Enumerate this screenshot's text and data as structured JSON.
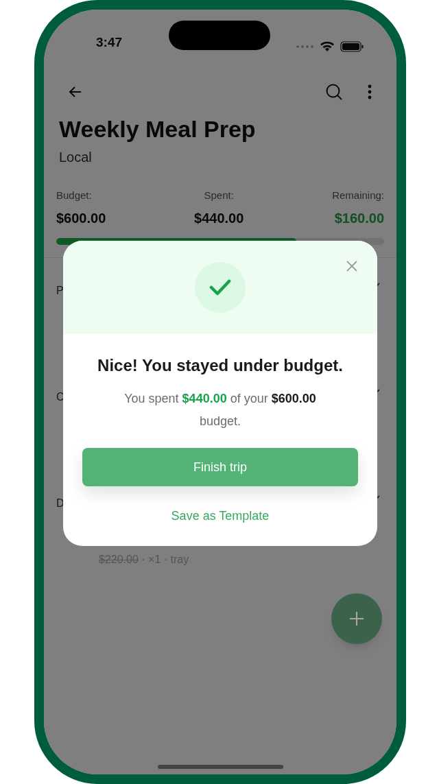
{
  "status_bar": {
    "time": "3:47"
  },
  "header": {
    "title": "Weekly Meal Prep",
    "subtitle": "Local"
  },
  "budget": {
    "stats": [
      {
        "label": "Budget:",
        "value": "$600.00",
        "kind": "plain"
      },
      {
        "label": "Spent:",
        "value": "$440.00",
        "kind": "plain"
      },
      {
        "label": "Remaining:",
        "value": "$160.00",
        "kind": "positive"
      }
    ],
    "level": 0.733
  },
  "sections": [
    {
      "label": "P"
    },
    {
      "label": "C"
    },
    {
      "label": "D"
    }
  ],
  "item": {
    "price": "$220.00",
    "struck": true,
    "meta": "· ×1 · tray"
  },
  "dialog": {
    "title": "Nice! You stayed under budget.",
    "message": [
      {
        "text": "You spent ",
        "kind": "plain"
      },
      {
        "text": "$440.00",
        "kind": "spent"
      },
      {
        "text": " of your ",
        "kind": "plain"
      },
      {
        "text": "$600.00",
        "kind": "strong"
      },
      {
        "text": " budget.",
        "kind": "plain"
      }
    ],
    "primary_button": "Finish trip",
    "secondary_link": "Save as Template"
  }
}
